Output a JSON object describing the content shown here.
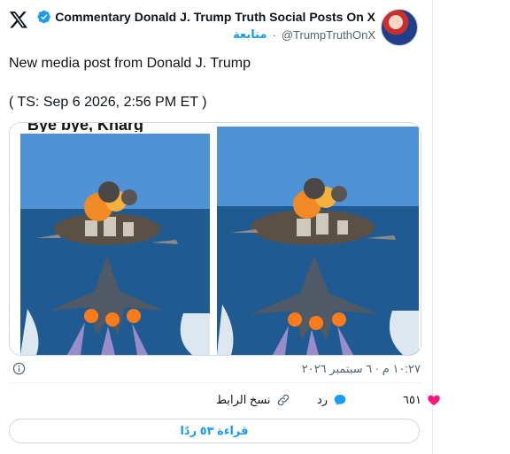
{
  "header": {
    "display_name": "Commentary Donald J. Trump Truth Social Posts On X",
    "handle": "@TrumpTruthOnX",
    "separator": "·",
    "follow_label": "متابعة"
  },
  "post": {
    "line1": "New media post from Donald J. Trump",
    "line2": "( TS: Sep 6 2026, 2:56 PM ET )",
    "image_caption": "Bye bye, Kharg",
    "timestamp": "١٠:٢٧ م · ٦ سبتمبر ٢٠٢٦"
  },
  "actions": {
    "like_count": "٦٥١",
    "reply_label": "رد",
    "copy_label": "نسخ الرابط"
  },
  "read_replies_label": "قراءة ٥٣ ردًا",
  "colors": {
    "accent": "#1d9bf0",
    "like": "#f91880",
    "muted": "#536471"
  }
}
